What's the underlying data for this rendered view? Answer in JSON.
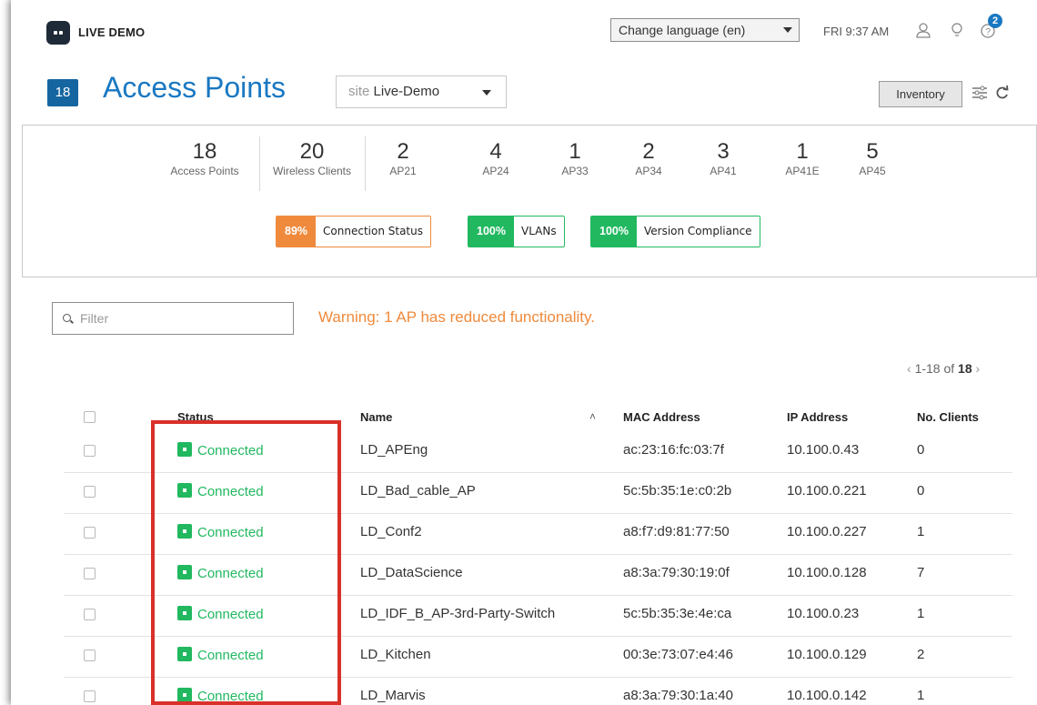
{
  "header": {
    "org_name": "LIVE DEMO",
    "language_label": "Change language (en)",
    "time": "FRI 9:37 AM",
    "help_badge": "2"
  },
  "page": {
    "count": "18",
    "title": "Access Points",
    "site_label": "site",
    "site_value": "Live-Demo",
    "inventory_label": "Inventory"
  },
  "stats": [
    {
      "value": "18",
      "label": "Access Points"
    },
    {
      "value": "20",
      "label": "Wireless Clients"
    },
    {
      "value": "2",
      "label": "AP21"
    },
    {
      "value": "4",
      "label": "AP24"
    },
    {
      "value": "1",
      "label": "AP33"
    },
    {
      "value": "2",
      "label": "AP34"
    },
    {
      "value": "3",
      "label": "AP41"
    },
    {
      "value": "1",
      "label": "AP41E"
    },
    {
      "value": "5",
      "label": "AP45"
    }
  ],
  "health": [
    {
      "pct": "89%",
      "label": "Connection Status",
      "color": "#ef8a3c"
    },
    {
      "pct": "100%",
      "label": "VLANs",
      "color": "#21b860"
    },
    {
      "pct": "100%",
      "label": "Version Compliance",
      "color": "#21b860"
    }
  ],
  "filter": {
    "placeholder": "Filter"
  },
  "warning": "Warning: 1 AP has reduced functionality.",
  "pager": {
    "range": "1-18 of",
    "total": "18"
  },
  "table": {
    "columns": [
      "Status",
      "Name",
      "MAC Address",
      "IP Address",
      "No. Clients"
    ],
    "rows": [
      {
        "status": "Connected",
        "name": "LD_APEng",
        "mac": "ac:23:16:fc:03:7f",
        "ip": "10.100.0.43",
        "clients": "0"
      },
      {
        "status": "Connected",
        "name": "LD_Bad_cable_AP",
        "mac": "5c:5b:35:1e:c0:2b",
        "ip": "10.100.0.221",
        "clients": "0"
      },
      {
        "status": "Connected",
        "name": "LD_Conf2",
        "mac": "a8:f7:d9:81:77:50",
        "ip": "10.100.0.227",
        "clients": "1"
      },
      {
        "status": "Connected",
        "name": "LD_DataScience",
        "mac": "a8:3a:79:30:19:0f",
        "ip": "10.100.0.128",
        "clients": "7"
      },
      {
        "status": "Connected",
        "name": "LD_IDF_B_AP-3rd-Party-Switch",
        "mac": "5c:5b:35:3e:4e:ca",
        "ip": "10.100.0.23",
        "clients": "1"
      },
      {
        "status": "Connected",
        "name": "LD_Kitchen",
        "mac": "00:3e:73:07:e4:46",
        "ip": "10.100.0.129",
        "clients": "2"
      },
      {
        "status": "Connected",
        "name": "LD_Marvis",
        "mac": "a8:3a:79:30:1a:40",
        "ip": "10.100.0.142",
        "clients": "1"
      }
    ]
  },
  "colors": {
    "accent": "#1a78c2",
    "connected": "#21b860",
    "warning": "#ef8a3c",
    "highlight": "#d9302a"
  }
}
